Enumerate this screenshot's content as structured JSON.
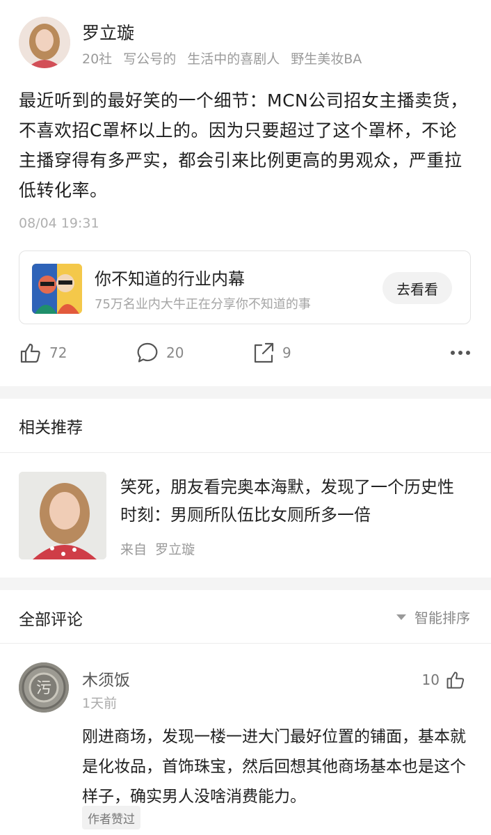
{
  "author": {
    "name": "罗立璇",
    "tags": [
      "20社",
      "写公号的",
      "生活中的喜剧人",
      "野生美妆BA"
    ]
  },
  "post": {
    "text": "最近听到的最好笑的一个细节：MCN公司招女主播卖货，不喜欢招C罩杯以上的。因为只要超过了这个罩杯，不论主播穿得有多严实，都会引来比例更高的男观众，严重拉低转化率。",
    "time": "08/04 19:31"
  },
  "promo": {
    "title": "你不知道的行业内幕",
    "subtitle": "75万名业内大牛正在分享你不知道的事",
    "button": "去看看"
  },
  "actions": {
    "likes": "72",
    "comments": "20",
    "shares": "9"
  },
  "related": {
    "section_title": "相关推荐",
    "item_title": "笑死，朋友看完奥本海默，发现了一个历史性时刻：男厕所队伍比女厕所多一倍",
    "from_label": "来自",
    "from_author": "罗立璇"
  },
  "comments": {
    "section_title": "全部评论",
    "sort_label": "智能排序",
    "items": [
      {
        "name": "木须饭",
        "time": "1天前",
        "likes": "10",
        "text": "刚进商场，发现一楼一进大门最好位置的铺面，基本就是化妆品，首饰珠宝，然后回想其他商场基本也是这个样子，确实男人没啥消费能力。",
        "badge": "作者赞过"
      }
    ]
  }
}
